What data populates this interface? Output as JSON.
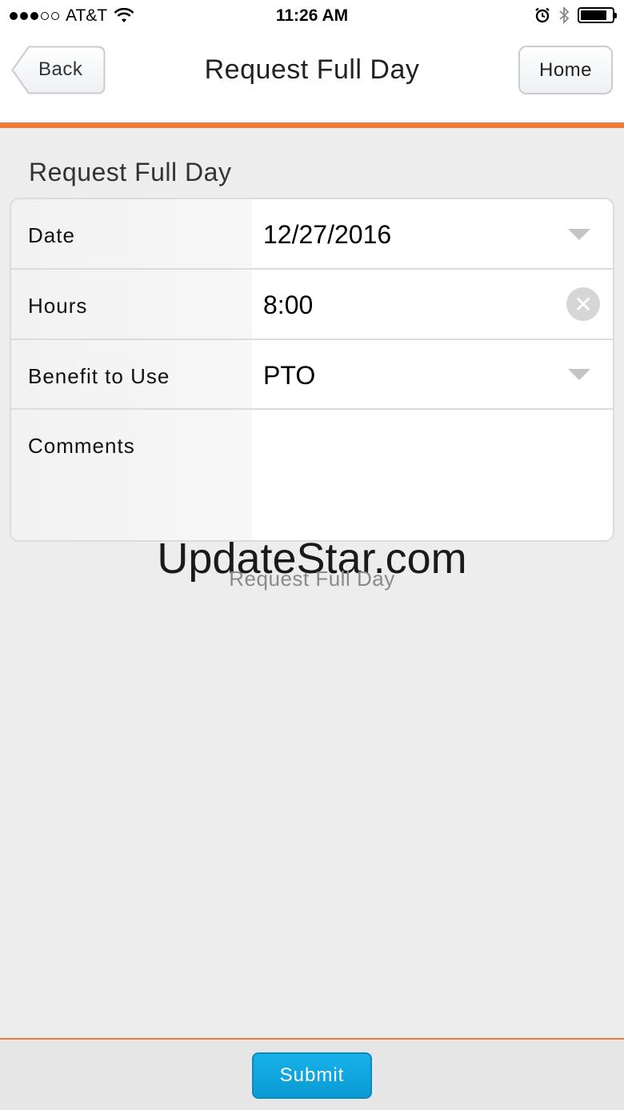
{
  "status_bar": {
    "carrier": "AT&T",
    "time": "11:26 AM",
    "signal_dots_filled": 3,
    "signal_dots_total": 5,
    "icons": [
      "wifi-icon",
      "alarm-icon",
      "bluetooth-icon",
      "battery-icon"
    ],
    "battery_level": 0.85
  },
  "header": {
    "back_label": "Back",
    "title": "Request Full Day",
    "home_label": "Home"
  },
  "section": {
    "title": "Request Full Day"
  },
  "form": {
    "date": {
      "label": "Date",
      "value": "12/27/2016"
    },
    "hours": {
      "label": "Hours",
      "value": "8:00"
    },
    "benefit": {
      "label": "Benefit to Use",
      "value": "PTO"
    },
    "comments": {
      "label": "Comments",
      "value": ""
    }
  },
  "watermark": "UpdateStar.com",
  "overlay_caption": "Request Full Day",
  "footer": {
    "submit_label": "Submit"
  },
  "colors": {
    "accent_orange": "#ef7c3b",
    "submit_blue": "#0fa5df",
    "background": "#ededed"
  }
}
